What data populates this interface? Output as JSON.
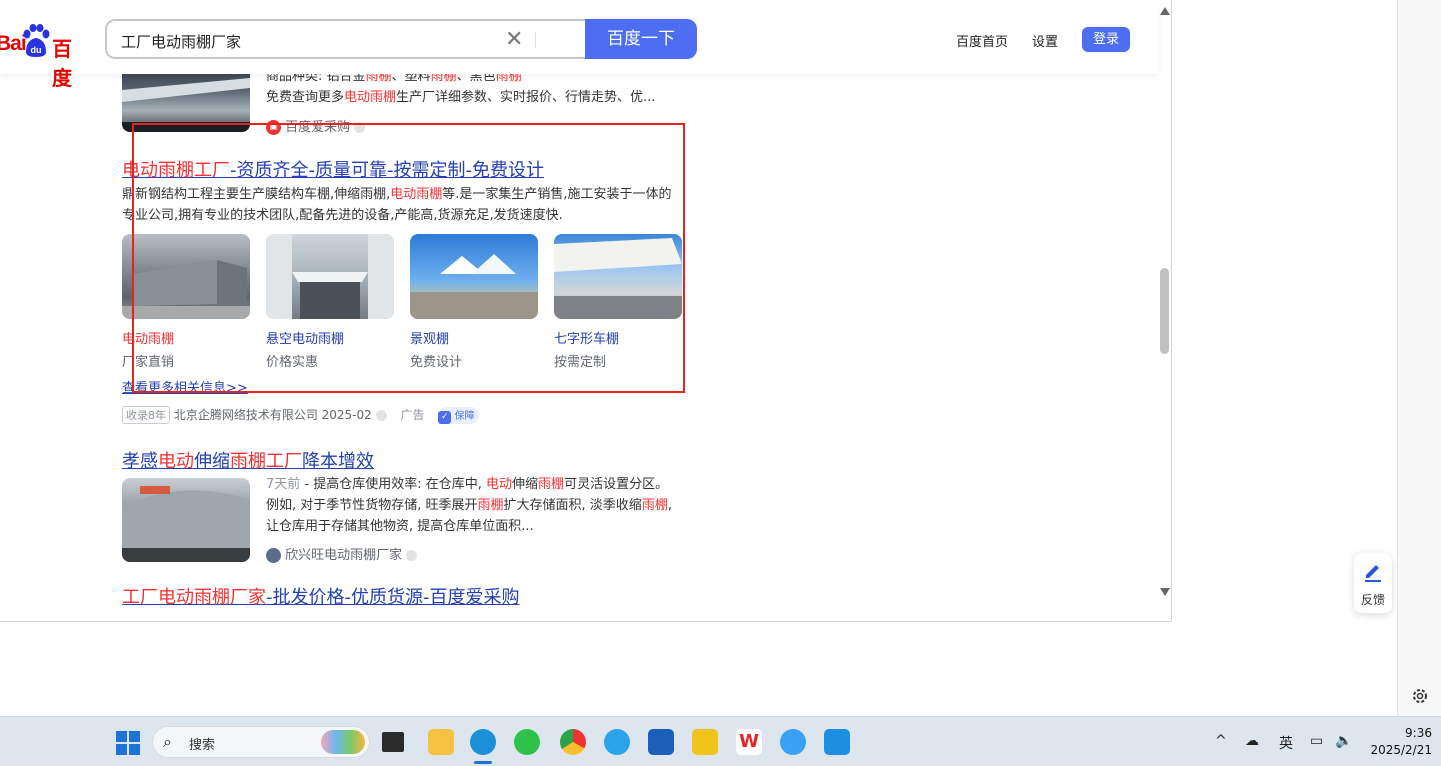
{
  "header": {
    "logo_text_left": "Bai",
    "logo_text_right": "百度",
    "search_value": "工厂电动雨棚厂家",
    "search_button": "百度一下",
    "nav_home": "百度首页",
    "nav_settings": "设置",
    "login": "登录"
  },
  "top_result": {
    "line1_a": "商品种类: 铝合金",
    "line1_b": "雨棚",
    "line1_c": "、塑料",
    "line1_d": "雨棚",
    "line1_e": "、黑色",
    "line1_f": "雨棚",
    "line2_a": "免费查询更多",
    "line2_b": "电动雨棚",
    "line2_c": "生产厂详细参数、实时报价、行情走势、优...",
    "source": "百度爱采购"
  },
  "ad_result": {
    "title_red": "电动雨棚工厂",
    "title_rest": "-资质齐全-质量可靠-按需定制-免费设计",
    "desc_a": "鼎新钢结构工程主要生产膜结构车棚,伸缩雨棚,",
    "desc_b": "电动雨棚",
    "desc_c": "等.是一家集生产销售,施工安装于一体的",
    "desc_d": "专业公司,拥有专业的技术团队,配备先进的设备,产能高,货源充足,发货速度快.",
    "items": [
      {
        "label": "电动雨棚",
        "sub": "厂家直销"
      },
      {
        "label": "悬空电动雨棚",
        "sub": "价格实惠"
      },
      {
        "label": "景观棚",
        "sub": "免费设计"
      },
      {
        "label": "七字形车棚",
        "sub": "按需定制"
      }
    ],
    "more": "查看更多相关信息>>",
    "record": "收录8年",
    "company": "北京企腾网络技术有限公司 2025-02",
    "ad_label": "广告",
    "guarantee": "保障"
  },
  "result3": {
    "title_a": "孝感",
    "title_b": "电动",
    "title_c": "伸缩",
    "title_d": "雨棚工厂",
    "title_e": "降本增效",
    "date": "7天前",
    "desc_a": " - 提高仓库使用效率: 在仓库中, ",
    "desc_b": "电动",
    "desc_c": "伸缩",
    "desc_d": "雨棚",
    "desc_e": "可灵活设置分区。",
    "desc_f": "例如, 对于季节性货物存储, 旺季展开",
    "desc_g": "雨棚",
    "desc_h": "扩大存储面积, 淡季收缩",
    "desc_i": "雨",
    "desc_j": "棚",
    "desc_k": ", 让仓库用于存储其他物资, 提高仓库单位面积...",
    "source": "欣兴旺电动雨棚厂家"
  },
  "result4": {
    "title_red": "工厂电动雨棚厂家",
    "title_rest": "-批发价格-优质货源-百度爱采购"
  },
  "feedback": "反馈",
  "taskbar": {
    "search_placeholder": "搜索",
    "ime": "英",
    "time": "9:36",
    "date": "2025/2/21"
  },
  "colors": {
    "accent": "#4e6ef2",
    "link": "#2440b3",
    "highlight": "#f73131",
    "annotation_box": "#e8231f"
  }
}
